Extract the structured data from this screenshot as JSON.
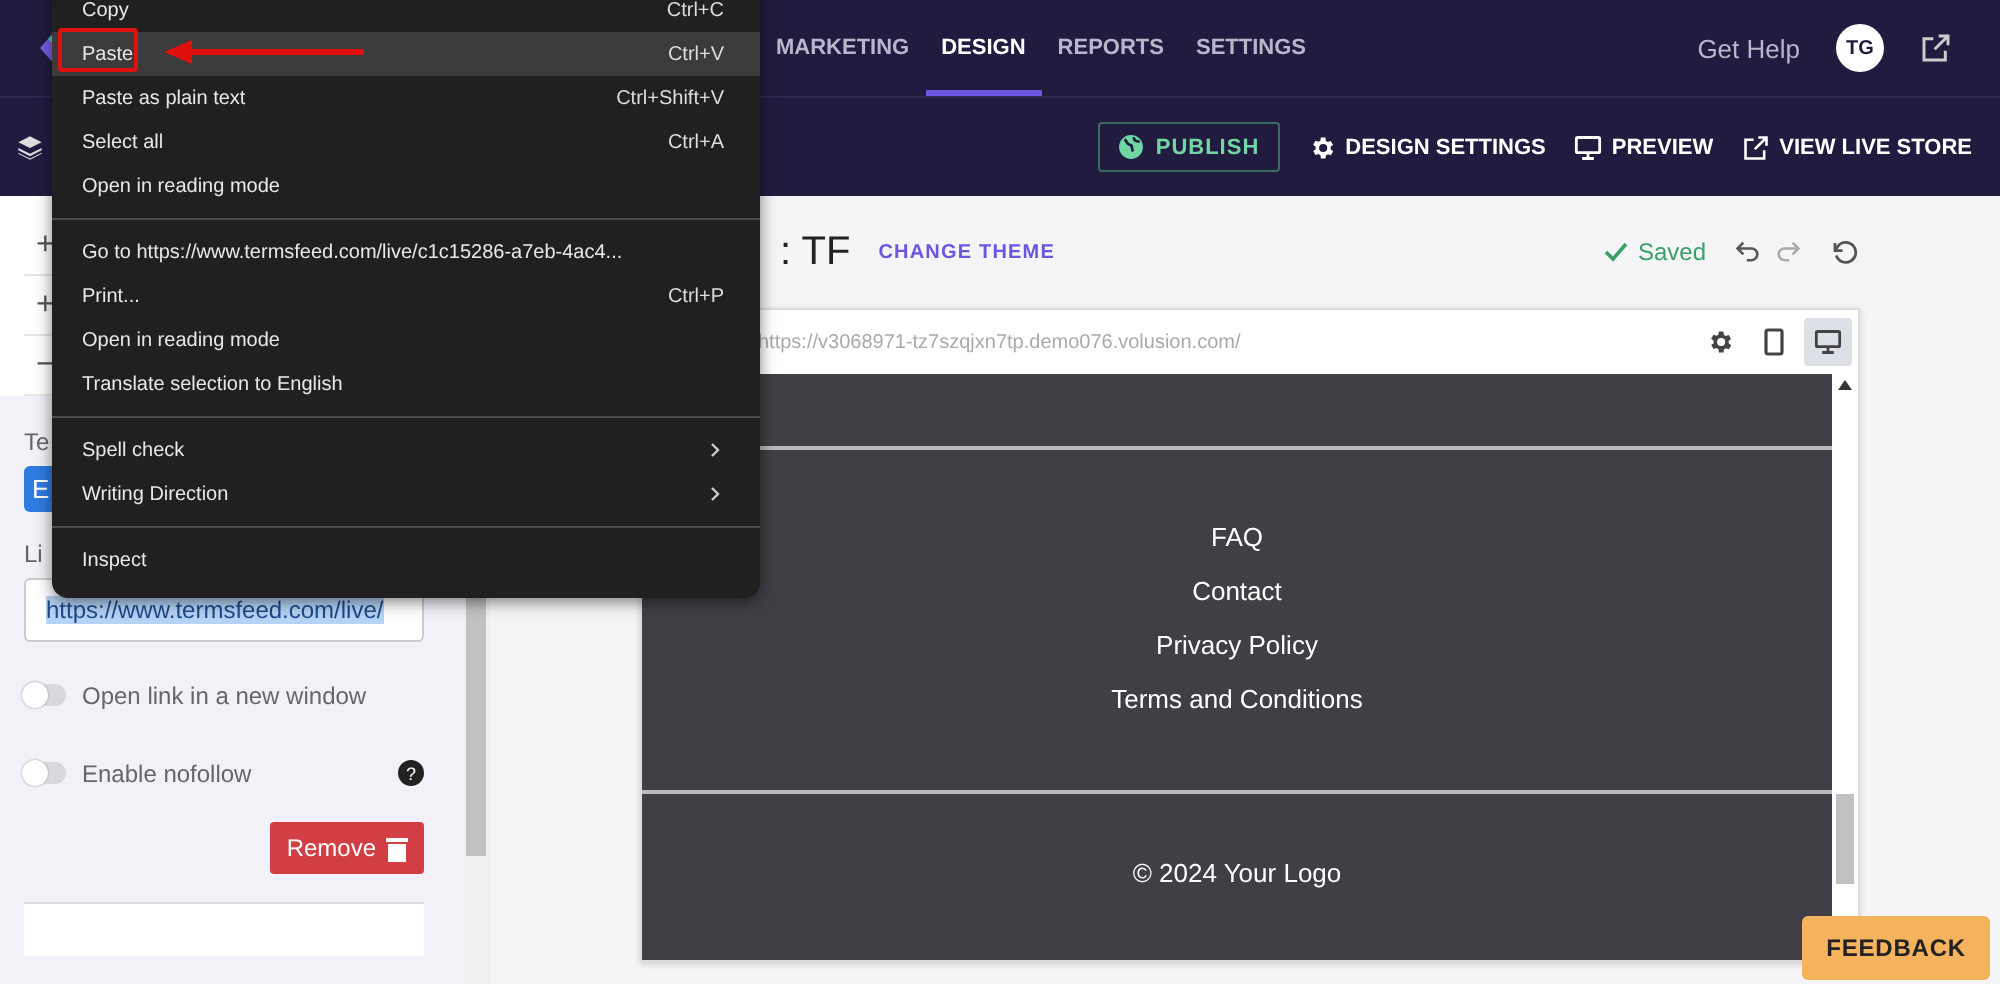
{
  "top_nav": {
    "tabs": [
      {
        "label": "MARKETING",
        "selected": false
      },
      {
        "label": "DESIGN",
        "selected": true
      },
      {
        "label": "REPORTS",
        "selected": false
      },
      {
        "label": "SETTINGS",
        "selected": false
      }
    ],
    "help": "Get Help",
    "avatar": "TG"
  },
  "toolbar": {
    "publish": "PUBLISH",
    "actions": [
      {
        "kind": "settings",
        "label": "DESIGN SETTINGS"
      },
      {
        "kind": "preview",
        "label": "PREVIEW"
      },
      {
        "kind": "external",
        "label": "VIEW LIVE STORE"
      }
    ]
  },
  "sidebar": {
    "rows": [
      "+",
      "+",
      "−"
    ],
    "text_label": "Te",
    "text_button": "E",
    "link_label": "Li",
    "link_value": "https://www.termsfeed.com/live/",
    "toggles": [
      {
        "label": "Open link in a new window",
        "on": false
      },
      {
        "label": "Enable nofollow",
        "on": false,
        "help_icon": "?"
      }
    ],
    "remove": "Remove"
  },
  "editor": {
    "title": ": TF",
    "change_theme": "CHANGE THEME",
    "status": "Saved",
    "url": "https://v3068971-tz7szqjxn7tp.demo076.volusion.com/",
    "devices": [
      {
        "kind": "settings",
        "selected": false
      },
      {
        "kind": "mobile",
        "selected": false
      },
      {
        "kind": "desktop",
        "selected": true
      }
    ]
  },
  "site": {
    "links": [
      "FAQ",
      "Contact",
      "Privacy Policy",
      "Terms and Conditions"
    ],
    "copyright": "© 2024 Your Logo"
  },
  "context_menu": {
    "sections": [
      [
        {
          "label": "Copy",
          "shortcut": "Ctrl+C",
          "highlighted": false,
          "submenu": false
        },
        {
          "label": "Paste",
          "shortcut": "Ctrl+V",
          "highlighted": true,
          "submenu": false
        },
        {
          "label": "Paste as plain text",
          "shortcut": "Ctrl+Shift+V",
          "highlighted": false,
          "submenu": false
        },
        {
          "label": "Select all",
          "shortcut": "Ctrl+A",
          "highlighted": false,
          "submenu": false
        },
        {
          "label": "Open in reading mode",
          "highlighted": false,
          "submenu": false
        }
      ],
      [
        {
          "label": "Go to https://www.termsfeed.com/live/c1c15286-a7eb-4ac4...",
          "highlighted": false,
          "submenu": false
        },
        {
          "label": "Print...",
          "shortcut": "Ctrl+P",
          "highlighted": false,
          "submenu": false
        },
        {
          "label": "Open in reading mode",
          "highlighted": false,
          "submenu": false
        },
        {
          "label": "Translate selection to English",
          "highlighted": false,
          "submenu": false
        }
      ],
      [
        {
          "label": "Spell check",
          "highlighted": false,
          "submenu": true
        },
        {
          "label": "Writing Direction",
          "highlighted": false,
          "submenu": true
        }
      ],
      [
        {
          "label": "Inspect",
          "highlighted": false,
          "submenu": false
        }
      ]
    ]
  },
  "feedback": "FEEDBACK"
}
